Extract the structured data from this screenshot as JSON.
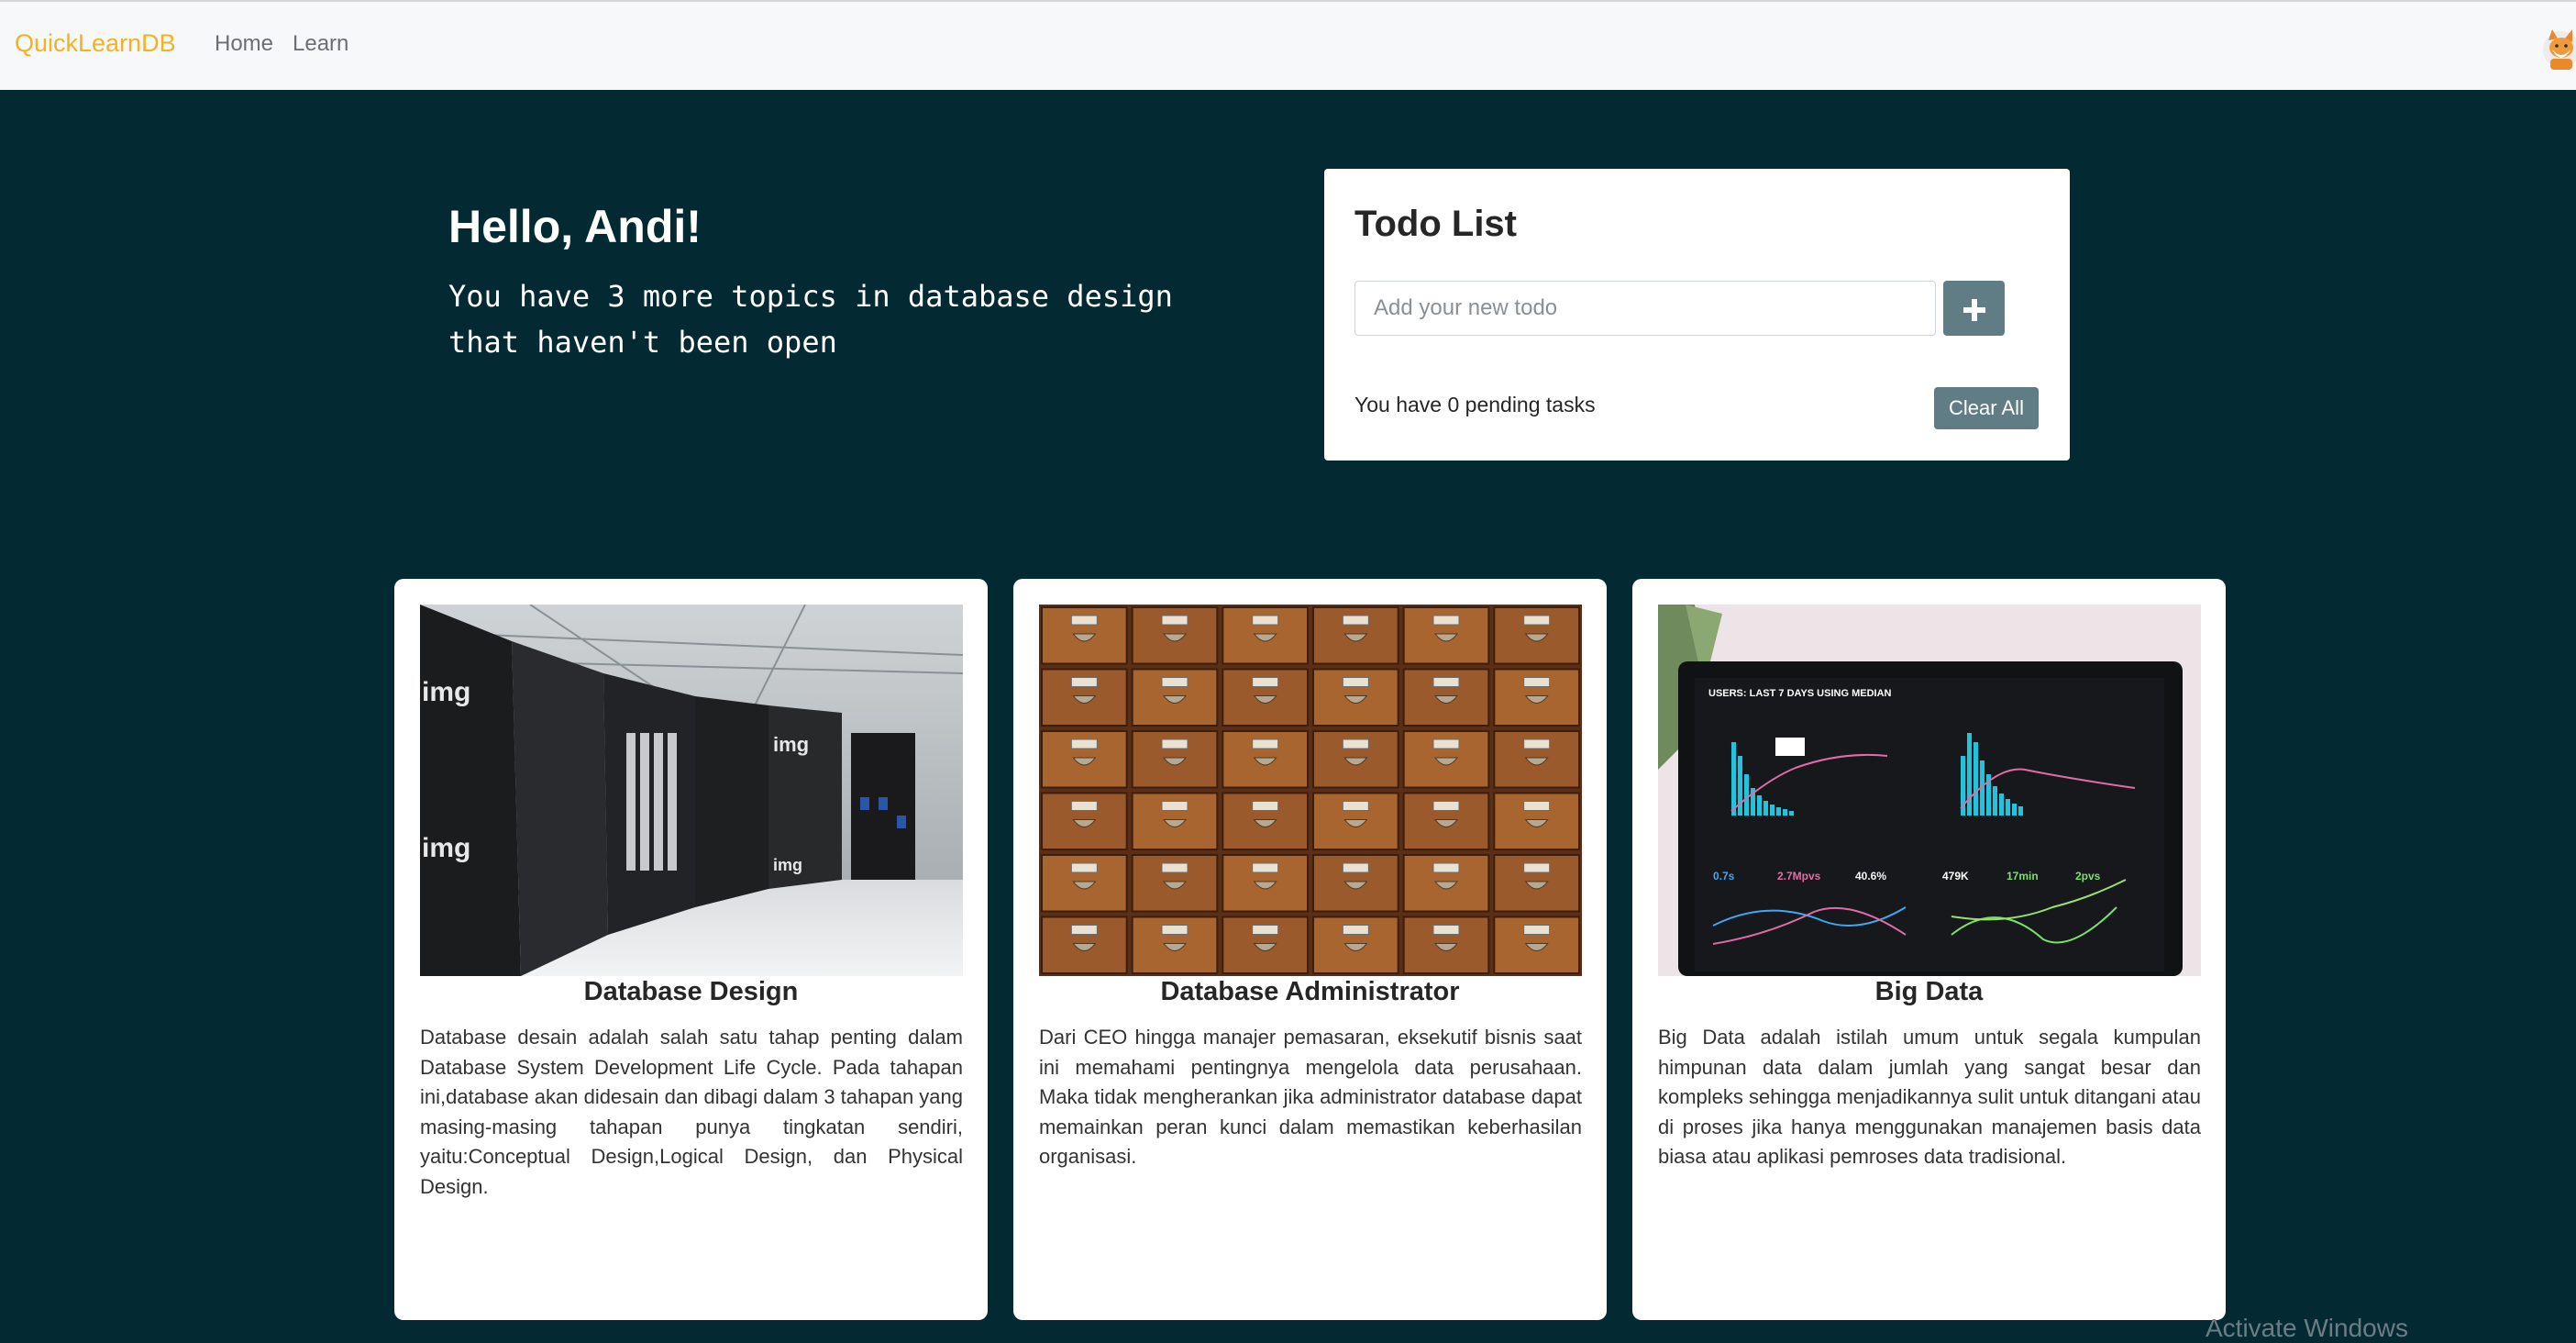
{
  "navbar": {
    "brand": "QuickLearnDB",
    "links": [
      "Home",
      "Learn"
    ],
    "brand_color": "#f5b120"
  },
  "hero": {
    "greeting": "Hello, Andi!",
    "subtitle": "You have 3 more topics in database design that haven't been open"
  },
  "todo": {
    "title": "Todo List",
    "input_placeholder": "Add your new todo",
    "add_icon": "plus-icon",
    "pending_text": "You have 0 pending tasks",
    "clear_label": "Clear All"
  },
  "cards": [
    {
      "title": "Database Design",
      "image": "server-room-photo",
      "description": "Database desain adalah salah satu tahap penting dalam Database System Development Life Cycle. Pada tahapan ini,database akan didesain dan dibagi dalam 3 tahapan yang masing-masing tahapan punya tingkatan sendiri, yaitu:Conceptual Design,Logical Design, dan Physical Design."
    },
    {
      "title": "Database Administrator",
      "image": "card-catalog-drawers-photo",
      "description": "Dari CEO hingga manajer pemasaran, eksekutif bisnis saat ini memahami pentingnya mengelola data perusahaan. Maka tidak mengherankan jika administrator database dapat memainkan peran kunci dalam memastikan keberhasilan organisasi."
    },
    {
      "title": "Big Data",
      "image": "analytics-dashboard-laptop-photo",
      "description": "Big Data adalah istilah umum untuk segala kumpulan himpunan data dalam jumlah yang sangat besar dan kompleks sehingga menjadikannya sulit untuk ditangani atau di proses jika hanya menggunakan manajemen basis data biasa atau aplikasi pemroses data tradisional."
    }
  ],
  "watermark": "Activate Windows",
  "colors": {
    "background": "#032a33",
    "button": "#607d85",
    "navbar": "#f7f8fa"
  }
}
